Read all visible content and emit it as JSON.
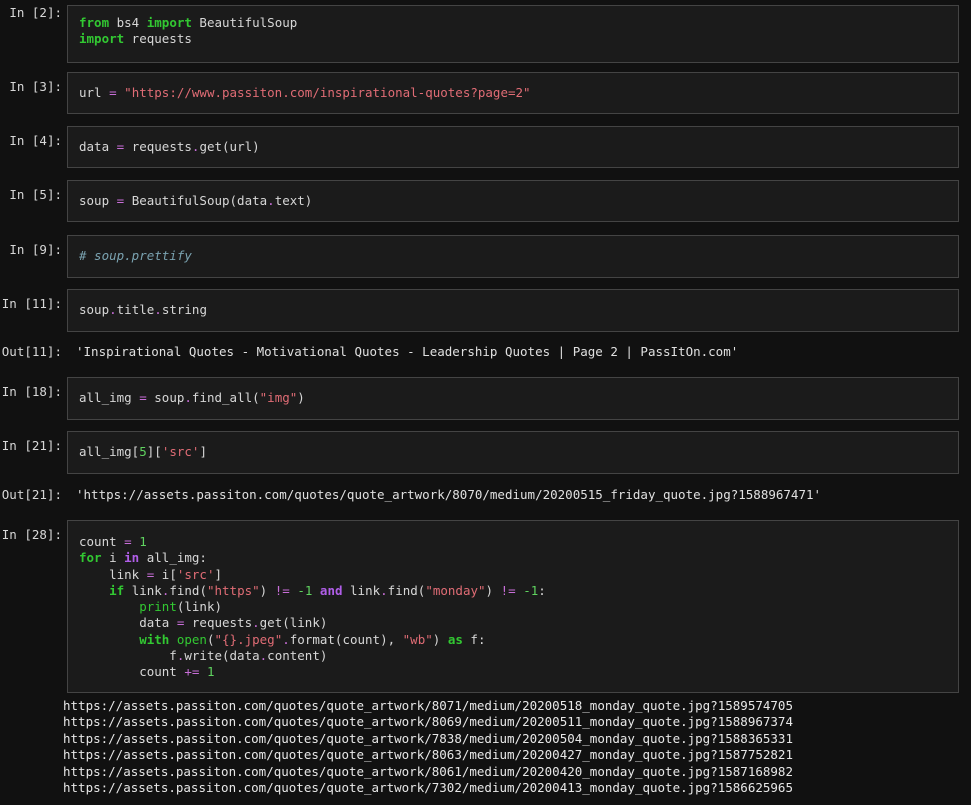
{
  "cells": [
    {
      "prompt": "In [2]:",
      "lines": [
        [
          {
            "t": "from",
            "c": "kw"
          },
          {
            "t": " bs4 ",
            "c": "nm"
          },
          {
            "t": "import",
            "c": "kw"
          },
          {
            "t": " BeautifulSoup",
            "c": "nm"
          }
        ],
        [
          {
            "t": "import",
            "c": "kw"
          },
          {
            "t": " requests",
            "c": "nm"
          }
        ]
      ]
    },
    {
      "prompt": "In [3]:",
      "lines": [
        [
          {
            "t": "url ",
            "c": "nm"
          },
          {
            "t": "=",
            "c": "op"
          },
          {
            "t": " ",
            "c": "nm"
          },
          {
            "t": "\"https://www.passiton.com/inspirational-quotes?page=2\"",
            "c": "str"
          }
        ]
      ]
    },
    {
      "prompt": "In [4]:",
      "lines": [
        [
          {
            "t": "data ",
            "c": "nm"
          },
          {
            "t": "=",
            "c": "op"
          },
          {
            "t": " requests",
            "c": "nm"
          },
          {
            "t": ".",
            "c": "op"
          },
          {
            "t": "get(url)",
            "c": "nm"
          }
        ]
      ]
    },
    {
      "prompt": "In [5]:",
      "lines": [
        [
          {
            "t": "soup ",
            "c": "nm"
          },
          {
            "t": "=",
            "c": "op"
          },
          {
            "t": " BeautifulSoup(data",
            "c": "nm"
          },
          {
            "t": ".",
            "c": "op"
          },
          {
            "t": "text)",
            "c": "nm"
          }
        ]
      ]
    },
    {
      "prompt": "In [9]:",
      "lines": [
        [
          {
            "t": "# soup.prettify",
            "c": "cm"
          }
        ]
      ]
    },
    {
      "prompt": "In [11]:",
      "lines": [
        [
          {
            "t": "soup",
            "c": "nm"
          },
          {
            "t": ".",
            "c": "op"
          },
          {
            "t": "title",
            "c": "nm"
          },
          {
            "t": ".",
            "c": "op"
          },
          {
            "t": "string",
            "c": "nm"
          }
        ]
      ],
      "out_prompt": "Out[11]:",
      "output": "'Inspirational Quotes - Motivational Quotes - Leadership Quotes | Page 2 | PassItOn.com'"
    },
    {
      "prompt": "In [18]:",
      "lines": [
        [
          {
            "t": "all_img ",
            "c": "nm"
          },
          {
            "t": "=",
            "c": "op"
          },
          {
            "t": " soup",
            "c": "nm"
          },
          {
            "t": ".",
            "c": "op"
          },
          {
            "t": "find_all(",
            "c": "nm"
          },
          {
            "t": "\"img\"",
            "c": "str"
          },
          {
            "t": ")",
            "c": "nm"
          }
        ]
      ]
    },
    {
      "prompt": "In [21]:",
      "lines": [
        [
          {
            "t": "all_img[",
            "c": "nm"
          },
          {
            "t": "5",
            "c": "num"
          },
          {
            "t": "][",
            "c": "nm"
          },
          {
            "t": "'src'",
            "c": "str"
          },
          {
            "t": "]",
            "c": "nm"
          }
        ]
      ],
      "out_prompt": "Out[21]:",
      "output": "'https://assets.passiton.com/quotes/quote_artwork/8070/medium/20200515_friday_quote.jpg?1588967471'"
    },
    {
      "prompt": "In [28]:",
      "lines": [
        [
          {
            "t": "count ",
            "c": "nm"
          },
          {
            "t": "=",
            "c": "op"
          },
          {
            "t": " ",
            "c": "nm"
          },
          {
            "t": "1",
            "c": "num"
          }
        ],
        [
          {
            "t": "for",
            "c": "kw"
          },
          {
            "t": " i ",
            "c": "nm"
          },
          {
            "t": "in",
            "c": "kw2"
          },
          {
            "t": " all_img:",
            "c": "nm"
          }
        ],
        [
          {
            "t": "    link ",
            "c": "nm"
          },
          {
            "t": "=",
            "c": "op"
          },
          {
            "t": " i[",
            "c": "nm"
          },
          {
            "t": "'src'",
            "c": "str"
          },
          {
            "t": "]",
            "c": "nm"
          }
        ],
        [
          {
            "t": "    ",
            "c": "nm"
          },
          {
            "t": "if",
            "c": "kw"
          },
          {
            "t": " link",
            "c": "nm"
          },
          {
            "t": ".",
            "c": "op"
          },
          {
            "t": "find(",
            "c": "nm"
          },
          {
            "t": "\"https\"",
            "c": "str"
          },
          {
            "t": ") ",
            "c": "nm"
          },
          {
            "t": "!=",
            "c": "op"
          },
          {
            "t": " ",
            "c": "nm"
          },
          {
            "t": "-1",
            "c": "num"
          },
          {
            "t": " ",
            "c": "nm"
          },
          {
            "t": "and",
            "c": "kw2"
          },
          {
            "t": " link",
            "c": "nm"
          },
          {
            "t": ".",
            "c": "op"
          },
          {
            "t": "find(",
            "c": "nm"
          },
          {
            "t": "\"monday\"",
            "c": "str"
          },
          {
            "t": ") ",
            "c": "nm"
          },
          {
            "t": "!=",
            "c": "op"
          },
          {
            "t": " ",
            "c": "nm"
          },
          {
            "t": "-1",
            "c": "num"
          },
          {
            "t": ":",
            "c": "nm"
          }
        ],
        [
          {
            "t": "        ",
            "c": "nm"
          },
          {
            "t": "print",
            "c": "bi"
          },
          {
            "t": "(link)",
            "c": "nm"
          }
        ],
        [
          {
            "t": "        data ",
            "c": "nm"
          },
          {
            "t": "=",
            "c": "op"
          },
          {
            "t": " requests",
            "c": "nm"
          },
          {
            "t": ".",
            "c": "op"
          },
          {
            "t": "get(link)",
            "c": "nm"
          }
        ],
        [
          {
            "t": "        ",
            "c": "nm"
          },
          {
            "t": "with",
            "c": "kw"
          },
          {
            "t": " ",
            "c": "nm"
          },
          {
            "t": "open",
            "c": "bi"
          },
          {
            "t": "(",
            "c": "nm"
          },
          {
            "t": "\"{}.jpeg\"",
            "c": "str"
          },
          {
            "t": ".",
            "c": "op"
          },
          {
            "t": "format(count), ",
            "c": "nm"
          },
          {
            "t": "\"wb\"",
            "c": "str"
          },
          {
            "t": ") ",
            "c": "nm"
          },
          {
            "t": "as",
            "c": "kw"
          },
          {
            "t": " f:",
            "c": "nm"
          }
        ],
        [
          {
            "t": "            f",
            "c": "nm"
          },
          {
            "t": ".",
            "c": "op"
          },
          {
            "t": "write(data",
            "c": "nm"
          },
          {
            "t": ".",
            "c": "op"
          },
          {
            "t": "content)",
            "c": "nm"
          }
        ],
        [
          {
            "t": "        count ",
            "c": "nm"
          },
          {
            "t": "+=",
            "c": "op"
          },
          {
            "t": " ",
            "c": "nm"
          },
          {
            "t": "1",
            "c": "num"
          }
        ]
      ],
      "stream": [
        "https://assets.passiton.com/quotes/quote_artwork/8071/medium/20200518_monday_quote.jpg?1589574705",
        "https://assets.passiton.com/quotes/quote_artwork/8069/medium/20200511_monday_quote.jpg?1588967374",
        "https://assets.passiton.com/quotes/quote_artwork/7838/medium/20200504_monday_quote.jpg?1588365331",
        "https://assets.passiton.com/quotes/quote_artwork/8063/medium/20200427_monday_quote.jpg?1587752821",
        "https://assets.passiton.com/quotes/quote_artwork/8061/medium/20200420_monday_quote.jpg?1587168982",
        "https://assets.passiton.com/quotes/quote_artwork/7302/medium/20200413_monday_quote.jpg?1586625965"
      ]
    }
  ]
}
